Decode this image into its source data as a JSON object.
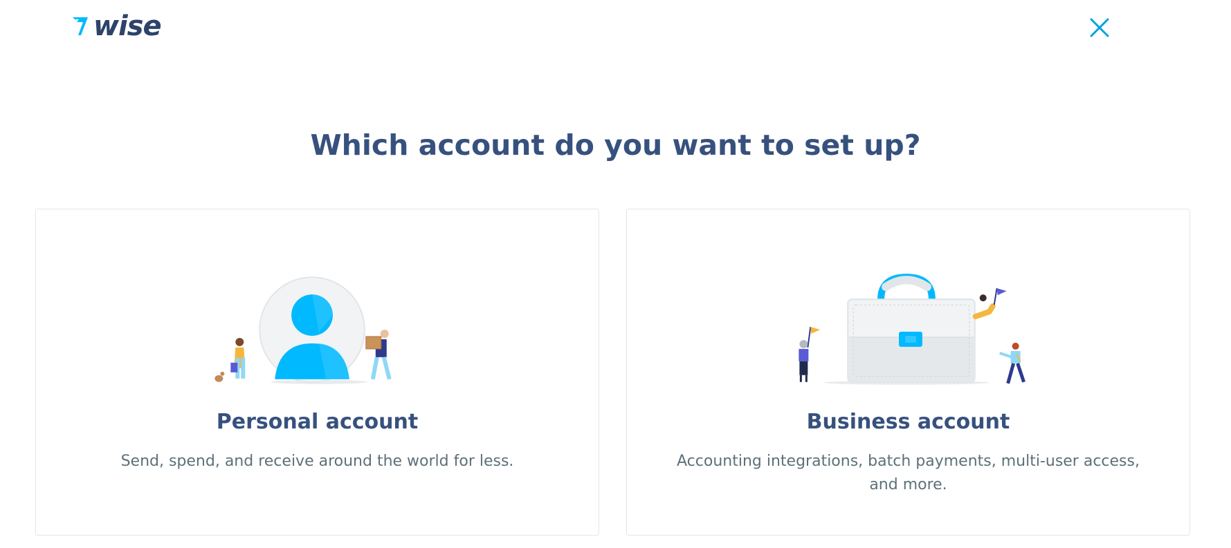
{
  "header": {
    "logo_text": "wise",
    "logo_icon": "wise-flag-icon",
    "close_icon": "close-icon"
  },
  "main": {
    "title": "Which account do you want to set up?"
  },
  "cards": {
    "personal": {
      "title": "Personal account",
      "description": "Send, spend, and receive around the world for less.",
      "illustration": "person-avatar-illustration"
    },
    "business": {
      "title": "Business account",
      "description": "Accounting integrations, batch payments, multi-user access, and more.",
      "illustration": "briefcase-illustration"
    }
  },
  "colors": {
    "brand_navy": "#37517e",
    "accent_blue": "#00b9ff",
    "text_secondary": "#5d7079",
    "card_border": "#e2e6e8"
  }
}
